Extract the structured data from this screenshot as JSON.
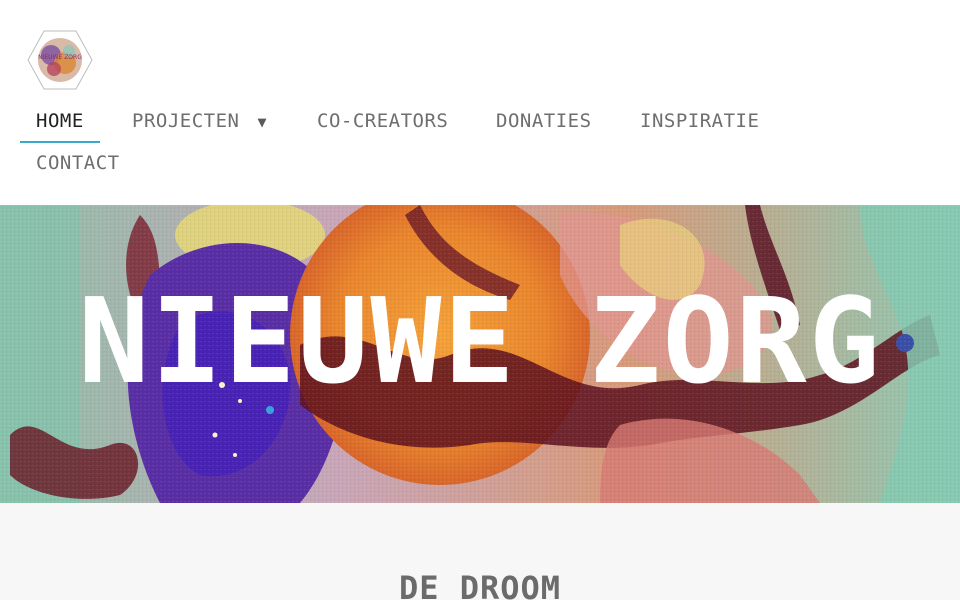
{
  "logo": {
    "icon": "hexagon-painting-logo",
    "text": "NIEUWE ZORG"
  },
  "nav": {
    "items": [
      {
        "label": "HOME",
        "active": true
      },
      {
        "label": "PROJECTEN",
        "has_dropdown": true,
        "dropdown_icon": "▼"
      },
      {
        "label": "CO-CREATORS"
      },
      {
        "label": "DONATIES"
      },
      {
        "label": "INSPIRATIE"
      },
      {
        "label": "CONTACT"
      }
    ],
    "accent_color": "#3ba9c9"
  },
  "hero": {
    "title": "NIEUWE ZORG"
  },
  "section": {
    "title": "DE DROOM"
  }
}
